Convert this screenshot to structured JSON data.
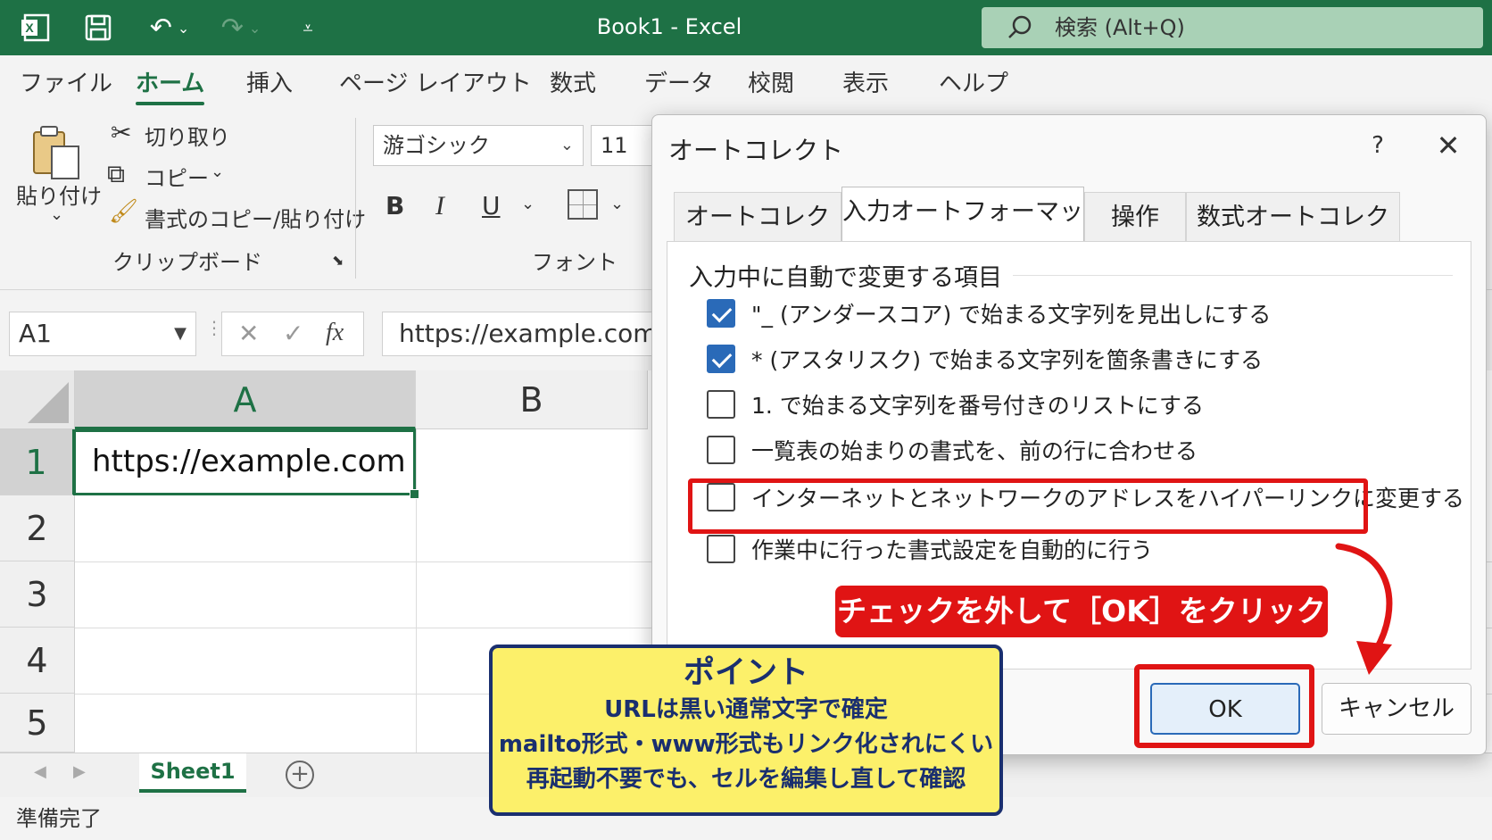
{
  "titlebar": {
    "title": "Book1  -  Excel",
    "search_placeholder": "検索 (Alt+Q)"
  },
  "ribbon_tabs": [
    "ファイル",
    "ホーム",
    "挿入",
    "ページ レイアウト",
    "数式",
    "データ",
    "校閲",
    "表示",
    "ヘルプ"
  ],
  "active_tab": "ホーム",
  "clipboard": {
    "paste_label": "貼り付け",
    "cut_label": "切り取り",
    "copy_label": "コピー",
    "format_painter_label": "書式のコピー/貼り付け",
    "group_label": "クリップボード"
  },
  "font": {
    "font_name": "游ゴシック",
    "font_size": "11",
    "bold": "B",
    "italic": "I",
    "underline": "U",
    "group_label": "フォント"
  },
  "formula_bar": {
    "name_box": "A1",
    "fx_label": "fx",
    "formula": "https://example.com"
  },
  "grid": {
    "columns": [
      "A",
      "B"
    ],
    "rows": [
      "1",
      "2",
      "3",
      "4",
      "5"
    ],
    "cell_a1": "https://example.com"
  },
  "sheet_tab": "Sheet1",
  "status": "準備完了",
  "dialog": {
    "title": "オートコレクト",
    "help": "?",
    "close": "✕",
    "tabs": [
      "オートコレクト",
      "入力オートフォーマット",
      "操作",
      "数式オートコレクト"
    ],
    "active_tab": "入力オートフォーマット",
    "group_label": "入力中に自動で変更する項目",
    "options": [
      {
        "label": "\"_ (アンダースコア) で始まる文字列を見出しにする",
        "checked": true
      },
      {
        "label": "* (アスタリスク) で始まる文字列を箇条書きにする",
        "checked": true
      },
      {
        "label": "1. で始まる文字列を番号付きのリストにする",
        "checked": false
      },
      {
        "label": "一覧表の始まりの書式を、前の行に合わせる",
        "checked": false
      },
      {
        "label": "インターネットとネットワークのアドレスをハイパーリンクに変更する",
        "checked": false
      },
      {
        "label": "作業中に行った書式設定を自動的に行う",
        "checked": false
      }
    ],
    "ok_label": "OK",
    "cancel_label": "キャンセル"
  },
  "annotation": {
    "callout": "チェックを外して［OK］をクリック",
    "point_title": "ポイント",
    "point_lines": [
      "URLは黒い通常文字で確定",
      "mailto形式・www形式もリンク化されにくい",
      "再起動不要でも、セルを編集し直して確認"
    ]
  },
  "colors": {
    "excel_green": "#1e7145",
    "highlight_red": "#e01414",
    "checkbox_blue": "#2a6ab8",
    "note_yellow": "#fcf06a",
    "note_navy": "#1a2f6f"
  }
}
